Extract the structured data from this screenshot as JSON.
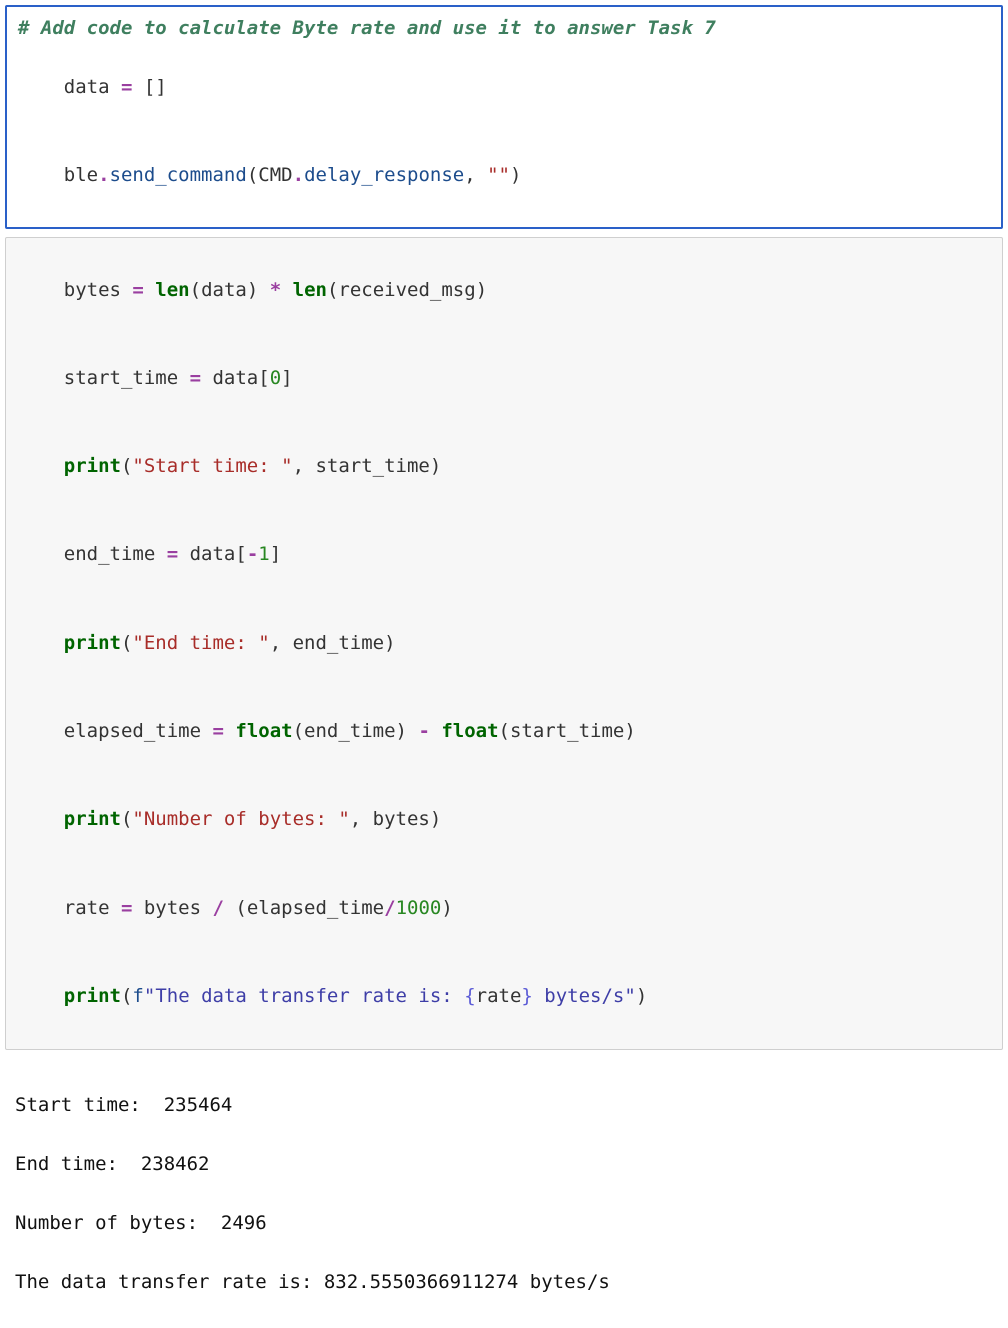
{
  "cell1": {
    "comment": "# Add code to calculate Byte rate and use it to answer Task 7",
    "line2": {
      "data": "data",
      "eq": " = ",
      "list": "[]"
    },
    "line3": {
      "ble": "ble",
      "dot1": ".",
      "send_command": "send_command",
      "open": "(",
      "cmd": "CMD",
      "dot2": ".",
      "delay_response": "delay_response",
      "comma": ", ",
      "empty": "\"\"",
      "close": ")"
    }
  },
  "cell2": {
    "l1": {
      "bytes": "bytes",
      "eq": " = ",
      "len1": "len",
      "open1": "(",
      "data": "data",
      "close1": ")",
      "star": " * ",
      "len2": "len",
      "open2": "(",
      "rm": "received_msg",
      "close2": ")"
    },
    "l2": {
      "st": "start_time",
      "eq": " = ",
      "data": "data",
      "open": "[",
      "zero": "0",
      "close": "]"
    },
    "l3": {
      "p": "print",
      "open": "(",
      "s": "\"Start time: \"",
      "comma": ", ",
      "st": "start_time",
      "close": ")"
    },
    "l4": {
      "et": "end_time",
      "eq": " = ",
      "data": "data",
      "open": "[",
      "neg1": "-1",
      "close": "]"
    },
    "l5": {
      "p": "print",
      "open": "(",
      "s": "\"End time: \"",
      "comma": ", ",
      "et": "end_time",
      "close": ")"
    },
    "l6": {
      "el": "elapsed_time",
      "eq": " = ",
      "float1": "float",
      "o1": "(",
      "et": "end_time",
      "c1": ")",
      "minus": " - ",
      "float2": "float",
      "o2": "(",
      "st": "start_time",
      "c2": ")"
    },
    "l7": {
      "p": "print",
      "open": "(",
      "s": "\"Number of bytes: \"",
      "comma": ", ",
      "bytes": "bytes",
      "close": ")"
    },
    "l8": {
      "rate": "rate",
      "eq": " = ",
      "bytes": "bytes",
      "div": " / ",
      "open": "(",
      "el": "elapsed_time",
      "div2": "/",
      "k": "1000",
      "close": ")"
    },
    "l9": {
      "p": "print",
      "open": "(",
      "f": "f",
      "q1": "\"",
      "txt1": "The data transfer rate is: ",
      "lb": "{",
      "rate": "rate",
      "rb": "}",
      "txt2": " bytes/s",
      "q2": "\"",
      "close": ")"
    }
  },
  "output": {
    "l1": "Start time:  235464",
    "l2": "End time:  238462",
    "l3": "Number of bytes:  2496",
    "l4": "The data transfer rate is: 832.5550366911274 bytes/s"
  }
}
